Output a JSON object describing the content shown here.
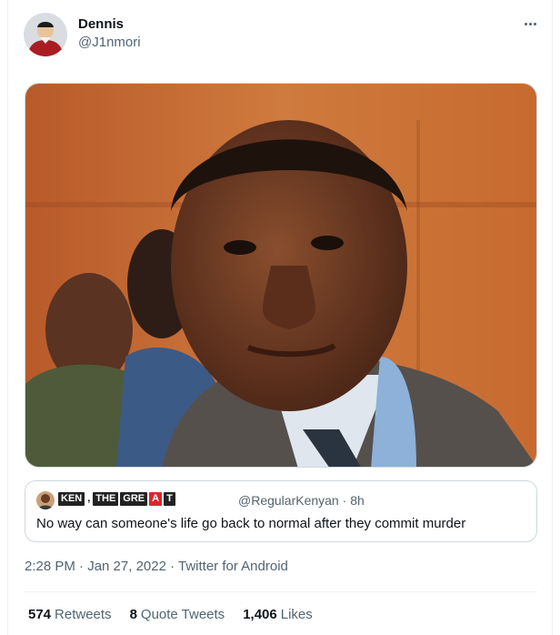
{
  "tweet": {
    "display_name": "Dennis",
    "handle": "@J1nmori",
    "more_icon": "more-horizontal-icon",
    "timestamp": "2:28 PM · Jan 27, 2022 · Twitter for Android",
    "stats": {
      "retweets_count": "574",
      "retweets_label": "Retweets",
      "quote_tweets_count": "8",
      "quote_tweets_label": "Quote Tweets",
      "likes_count": "1,406",
      "likes_label": "Likes"
    }
  },
  "quoted_tweet": {
    "name_tiles": [
      "KEN",
      ",",
      "THE",
      "GRE",
      "A",
      "T"
    ],
    "handle": "@RegularKenyan",
    "separator": "·",
    "age": "8h",
    "text": "No way can someone's life go back to normal after they commit murder"
  },
  "colors": {
    "text_primary": "#0f1419",
    "text_secondary": "#536471",
    "border": "#cfd9de",
    "accent_red": "#d8282f"
  }
}
